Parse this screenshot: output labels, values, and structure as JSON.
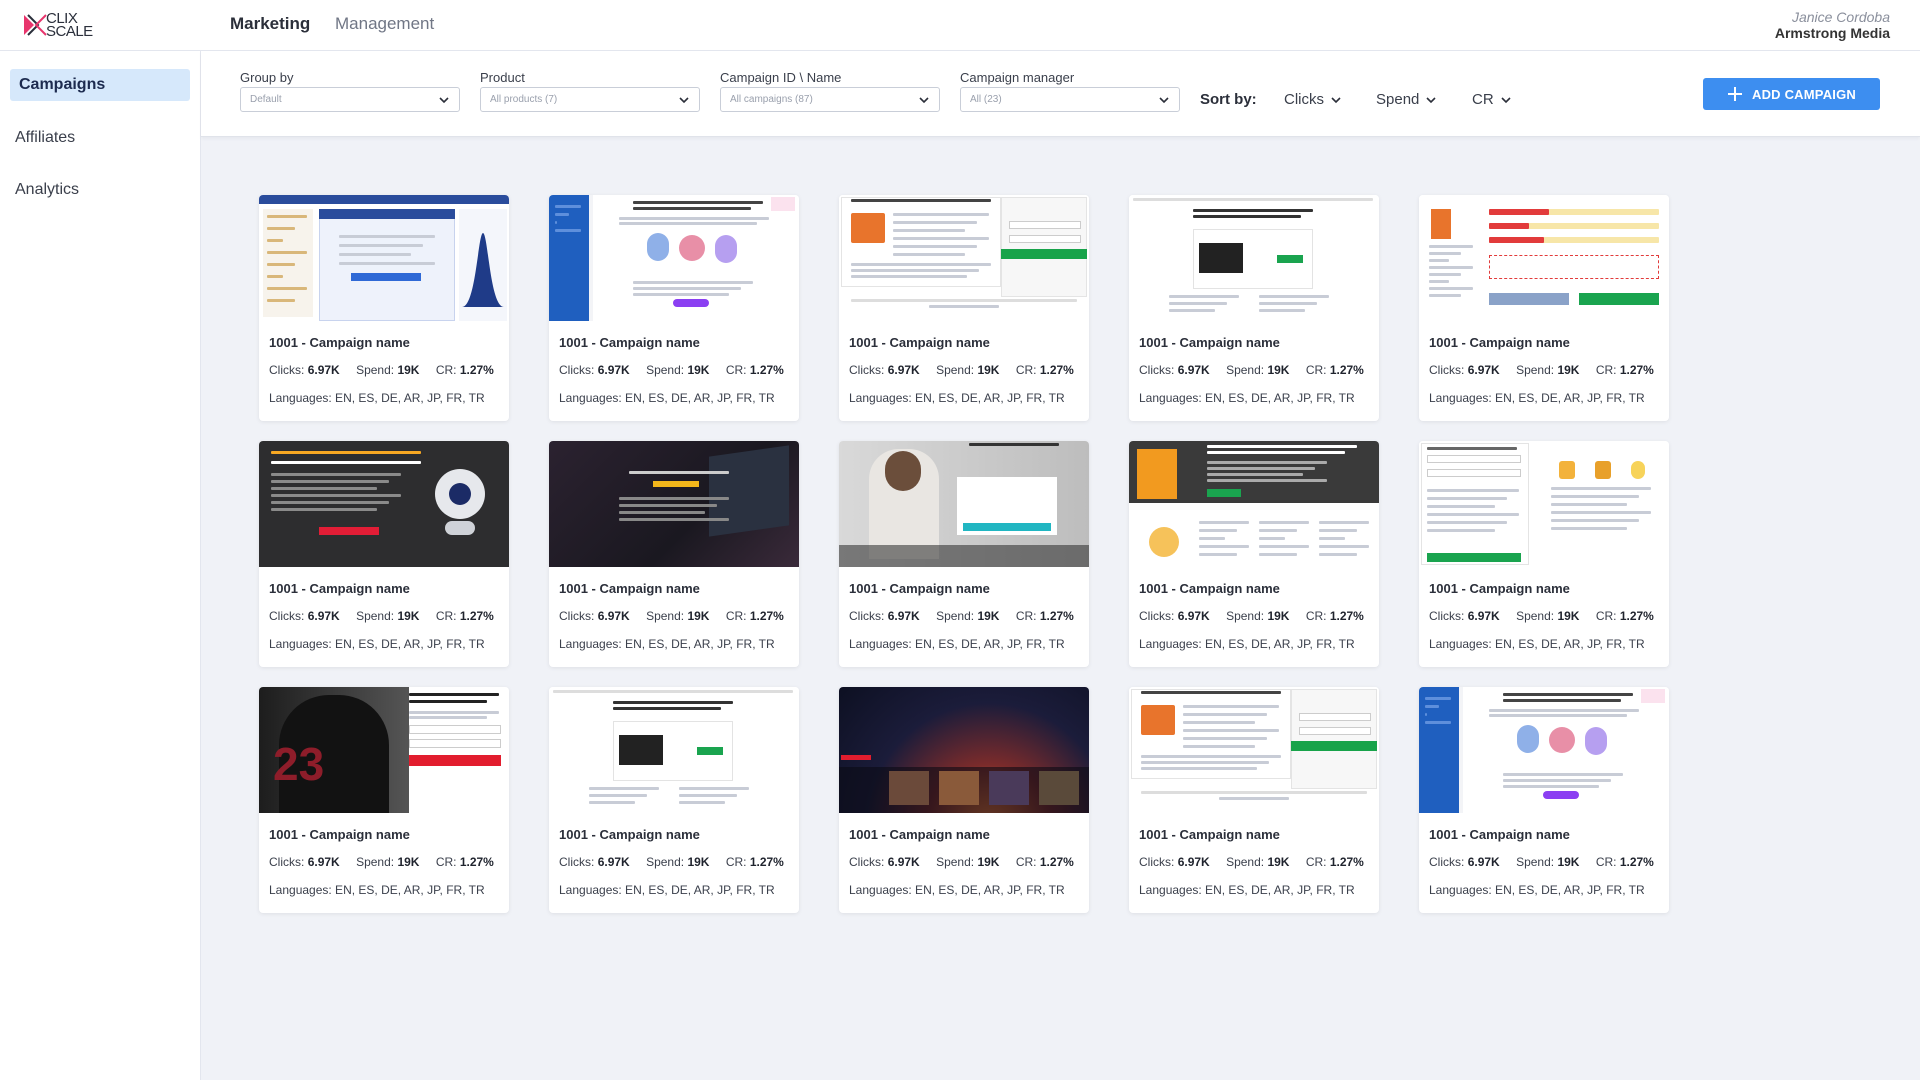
{
  "brand": {
    "logo_line1": "CLIX",
    "logo_line2": "SCALE"
  },
  "nav": {
    "tabs": [
      {
        "label": "Marketing",
        "active": true
      },
      {
        "label": "Management",
        "active": false
      }
    ]
  },
  "user": {
    "name": "Janice Cordoba",
    "org": "Armstrong Media"
  },
  "sidebar": {
    "items": [
      {
        "label": "Campaigns",
        "active": true
      },
      {
        "label": "Affiliates",
        "active": false
      },
      {
        "label": "Analytics",
        "active": false
      }
    ]
  },
  "filters": {
    "group_by": {
      "label": "Group by",
      "value": "Default"
    },
    "product": {
      "label": "Product",
      "value": "All products (7)"
    },
    "campaign": {
      "label": "Campaign ID \\ Name",
      "value": "All campaigns (87)"
    },
    "manager": {
      "label": "Campaign manager",
      "value": "All (23)"
    },
    "sort_label": "Sort by:",
    "sort_options": [
      "Clicks",
      "Spend",
      "CR"
    ]
  },
  "add_button": "ADD CAMPAIGN",
  "colors": {
    "accent": "#3d8ef0",
    "active_nav": "#d6e8fb",
    "background": "#f0f2f7"
  },
  "cards": [
    {
      "name": "1001 - Campaign name",
      "clicks_label": "Clicks:",
      "clicks": "6.97K",
      "spend_label": "Spend:",
      "spend": "19K",
      "cr_label": "CR:",
      "cr": "1.27%",
      "languages": "Languages: EN, ES, DE, AR, JP, FR, TR",
      "thumb": "iq-test"
    },
    {
      "name": "1001 - Campaign name",
      "clicks_label": "Clicks:",
      "clicks": "6.97K",
      "spend_label": "Spend:",
      "spend": "19K",
      "cr_label": "CR:",
      "cr": "1.27%",
      "languages": "Languages: EN, ES, DE, AR, JP, FR, TR",
      "thumb": "covid-blue"
    },
    {
      "name": "1001 - Campaign name",
      "clicks_label": "Clicks:",
      "clicks": "6.97K",
      "spend_label": "Spend:",
      "spend": "19K",
      "cr_label": "CR:",
      "cr": "1.27%",
      "languages": "Languages: EN, ES, DE, AR, JP, FR, TR",
      "thumb": "security-signup"
    },
    {
      "name": "1001 - Campaign name",
      "clicks_label": "Clicks:",
      "clicks": "6.97K",
      "spend_label": "Spend:",
      "spend": "19K",
      "cr_label": "CR:",
      "cr": "1.27%",
      "languages": "Languages: EN, ES, DE, AR, JP, FR, TR",
      "thumb": "free-unlimited"
    },
    {
      "name": "1001 - Campaign name",
      "clicks_label": "Clicks:",
      "clicks": "6.97K",
      "spend_label": "Spend:",
      "spend": "19K",
      "cr_label": "CR:",
      "cr": "1.27%",
      "languages": "Languages: EN, ES, DE, AR, JP, FR, TR",
      "thumb": "scan-bars"
    },
    {
      "name": "1001 - Campaign name",
      "clicks_label": "Clicks:",
      "clicks": "6.97K",
      "spend_label": "Spend:",
      "spend": "19K",
      "cr_label": "CR:",
      "cr": "1.27%",
      "languages": "Languages: EN, ES, DE, AR, JP, FR, TR",
      "thumb": "webcam"
    },
    {
      "name": "1001 - Campaign name",
      "clicks_label": "Clicks:",
      "clicks": "6.97K",
      "spend_label": "Spend:",
      "spend": "19K",
      "cr_label": "CR:",
      "cr": "1.27%",
      "languages": "Languages: EN, ES, DE, AR, JP, FR, TR",
      "thumb": "dark-private"
    },
    {
      "name": "1001 - Campaign name",
      "clicks_label": "Clicks:",
      "clicks": "6.97K",
      "spend_label": "Spend:",
      "spend": "19K",
      "cr_label": "CR:",
      "cr": "1.27%",
      "languages": "Languages: EN, ES, DE, AR, JP, FR, TR",
      "thumb": "fitness"
    },
    {
      "name": "1001 - Campaign name",
      "clicks_label": "Clicks:",
      "clicks": "6.97K",
      "spend_label": "Spend:",
      "spend": "19K",
      "cr_label": "CR:",
      "cr": "1.27%",
      "languages": "Languages: EN, ES, DE, AR, JP, FR, TR",
      "thumb": "pc-protection"
    },
    {
      "name": "1001 - Campaign name",
      "clicks_label": "Clicks:",
      "clicks": "6.97K",
      "spend_label": "Spend:",
      "spend": "19K",
      "cr_label": "CR:",
      "cr": "1.27%",
      "languages": "Languages: EN, ES, DE, AR, JP, FR, TR",
      "thumb": "password-form"
    },
    {
      "name": "1001 - Campaign name",
      "clicks_label": "Clicks:",
      "clicks": "6.97K",
      "spend_label": "Spend:",
      "spend": "19K",
      "cr_label": "CR:",
      "cr": "1.27%",
      "languages": "Languages: EN, ES, DE, AR, JP, FR, TR",
      "thumb": "sports"
    },
    {
      "name": "1001 - Campaign name",
      "clicks_label": "Clicks:",
      "clicks": "6.97K",
      "spend_label": "Spend:",
      "spend": "19K",
      "cr_label": "CR:",
      "cr": "1.27%",
      "languages": "Languages: EN, ES, DE, AR, JP, FR, TR",
      "thumb": "free-unlimited-2"
    },
    {
      "name": "1001 - Campaign name",
      "clicks_label": "Clicks:",
      "clicks": "6.97K",
      "spend_label": "Spend:",
      "spend": "19K",
      "cr_label": "CR:",
      "cr": "1.27%",
      "languages": "Languages: EN, ES, DE, AR, JP, FR, TR",
      "thumb": "movies"
    },
    {
      "name": "1001 - Campaign name",
      "clicks_label": "Clicks:",
      "clicks": "6.97K",
      "spend_label": "Spend:",
      "spend": "19K",
      "cr_label": "CR:",
      "cr": "1.27%",
      "languages": "Languages: EN, ES, DE, AR, JP, FR, TR",
      "thumb": "security-signup-2"
    },
    {
      "name": "1001 - Campaign name",
      "clicks_label": "Clicks:",
      "clicks": "6.97K",
      "spend_label": "Spend:",
      "spend": "19K",
      "cr_label": "CR:",
      "cr": "1.27%",
      "languages": "Languages: EN, ES, DE, AR, JP, FR, TR",
      "thumb": "covid-blue-2"
    }
  ]
}
